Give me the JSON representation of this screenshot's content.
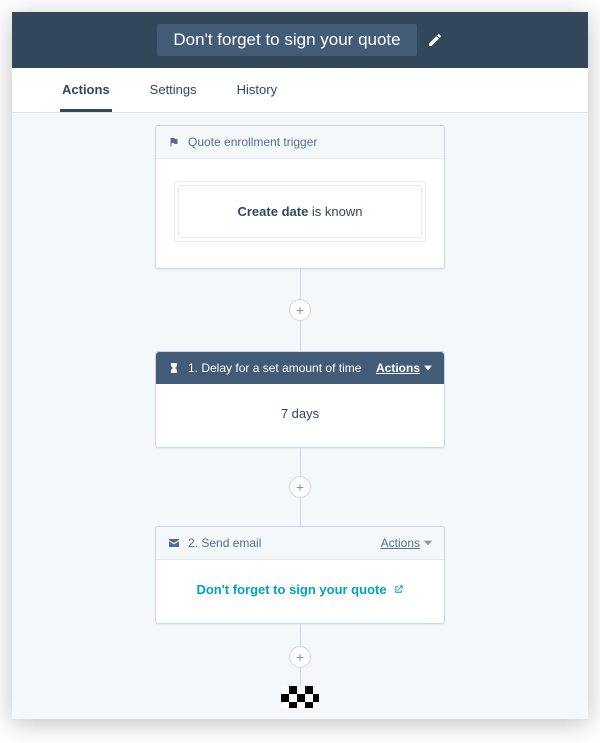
{
  "header": {
    "title": "Don't forget to sign your quote"
  },
  "tabs": {
    "items": [
      {
        "label": "Actions",
        "active": true
      },
      {
        "label": "Settings",
        "active": false
      },
      {
        "label": "History",
        "active": false
      }
    ]
  },
  "flow": {
    "trigger": {
      "header": "Quote enrollment trigger",
      "condition_prop": "Create date",
      "condition_state": "is known"
    },
    "step1": {
      "header": "1. Delay for a set amount of time",
      "actions_label": "Actions",
      "body": "7 days"
    },
    "step2": {
      "header": "2. Send email",
      "actions_label": "Actions",
      "email_name": "Don't forget to sign your quote"
    }
  }
}
